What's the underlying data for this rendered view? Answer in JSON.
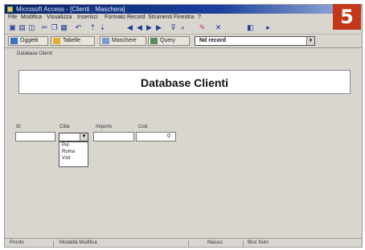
{
  "window": {
    "title": "Microsoft Access - [Clienti : Maschera]"
  },
  "menu": {
    "items": [
      "File",
      "Modifica",
      "Visualizza",
      "Inserisci",
      "Formato",
      "Record",
      "Strumenti",
      "Finestra",
      "?"
    ]
  },
  "toolbar": {
    "icons": [
      "save-icon",
      "print-icon",
      "preview-icon",
      "cut-icon",
      "copy-icon",
      "paste-icon",
      "undo-icon",
      "sort-asc-icon",
      "sort-desc-icon",
      "first-record-icon",
      "prev-record-icon",
      "next-record-icon",
      "last-record-icon",
      "filter-icon",
      "find-icon",
      "new-record-icon",
      "delete-record-icon",
      "database-window-icon",
      "help-icon"
    ]
  },
  "toolbar2": {
    "tabs": [
      "Oggetti",
      "Tabelle",
      "Maschere",
      "Query"
    ],
    "record_combo": "Nd record"
  },
  "breadcrumb": "Database Clienti",
  "form": {
    "title": "Database Clienti",
    "fields": {
      "id_label": "ID",
      "city_label": "Città",
      "code_label": "Importo",
      "amount_label": "Cod.",
      "amount_value": "0"
    },
    "dropdown": {
      "selected": "",
      "options": [
        "Pol",
        "Roma",
        "Vzd"
      ]
    }
  },
  "status": {
    "left": "Pronto",
    "mode": "Modalità Modifica",
    "caps": "Maiusc",
    "num": "Bloc Num"
  },
  "badge": {
    "number": "5",
    "color": "#c4371a"
  }
}
